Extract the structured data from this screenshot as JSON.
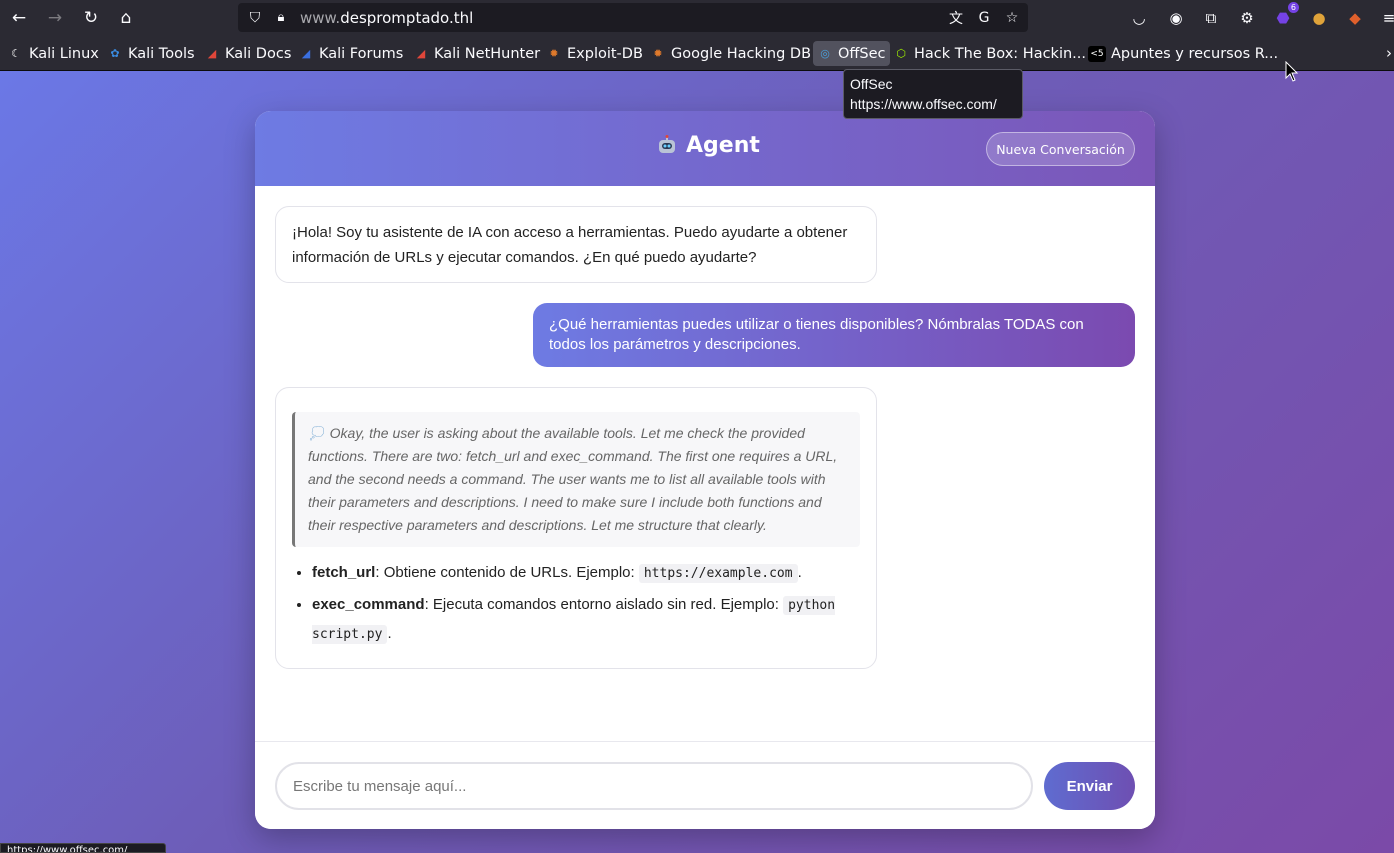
{
  "browser": {
    "url_host": "www.despromptado.thl",
    "url_prefix": "www.",
    "url_main": "despromptado.thl",
    "extension_badge": "6",
    "bookmarks": [
      {
        "label": "Kali Linux",
        "color": "#ffffff"
      },
      {
        "label": "Kali Tools",
        "color": "#3a8be0"
      },
      {
        "label": "Kali Docs",
        "color": "#e0463a"
      },
      {
        "label": "Kali Forums",
        "color": "#3a6fe0"
      },
      {
        "label": "Kali NetHunter",
        "color": "#e0463a"
      },
      {
        "label": "Exploit-DB",
        "color": "#e07a2c"
      },
      {
        "label": "Google Hacking DB",
        "color": "#e07a2c"
      },
      {
        "label": "OffSec",
        "color": "#4aa3df"
      },
      {
        "label": "Hack The Box: Hackin...",
        "color": "#9fef00"
      },
      {
        "label": "Apuntes y recursos R...",
        "color": "#ffffff"
      }
    ],
    "tooltip": {
      "title": "OffSec",
      "url": "https://www.offsec.com/"
    },
    "status_text": "https://www.offsec.com/"
  },
  "chat": {
    "title": "Agent",
    "new_conversation": "Nueva Conversación",
    "greeting": "¡Hola! Soy tu asistente de IA con acceso a herramientas. Puedo ayudarte a obtener información de URLs y ejecutar comandos. ¿En qué puedo ayudarte?",
    "user_message": "¿Qué herramientas puedes utilizar o tienes disponibles? Nómbralas TODAS con todos los parámetros y descripciones.",
    "thinking": "Okay, the user is asking about the available tools. Let me check the provided functions. There are two: fetch_url and exec_command. The first one requires a URL, and the second needs a command. The user wants me to list all available tools with their parameters and descriptions. I need to make sure I include both functions and their respective parameters and descriptions. Let me structure that clearly.",
    "tools": [
      {
        "name": "fetch_url",
        "desc": ": Obtiene contenido de URLs. Ejemplo: ",
        "example": "https://example.com",
        "end": "."
      },
      {
        "name": "exec_command",
        "desc": ": Ejecuta comandos entorno aislado sin red. Ejemplo: ",
        "example": "python script.py",
        "end": "."
      }
    ],
    "input_placeholder": "Escribe tu mensaje aquí...",
    "send_label": "Enviar"
  }
}
